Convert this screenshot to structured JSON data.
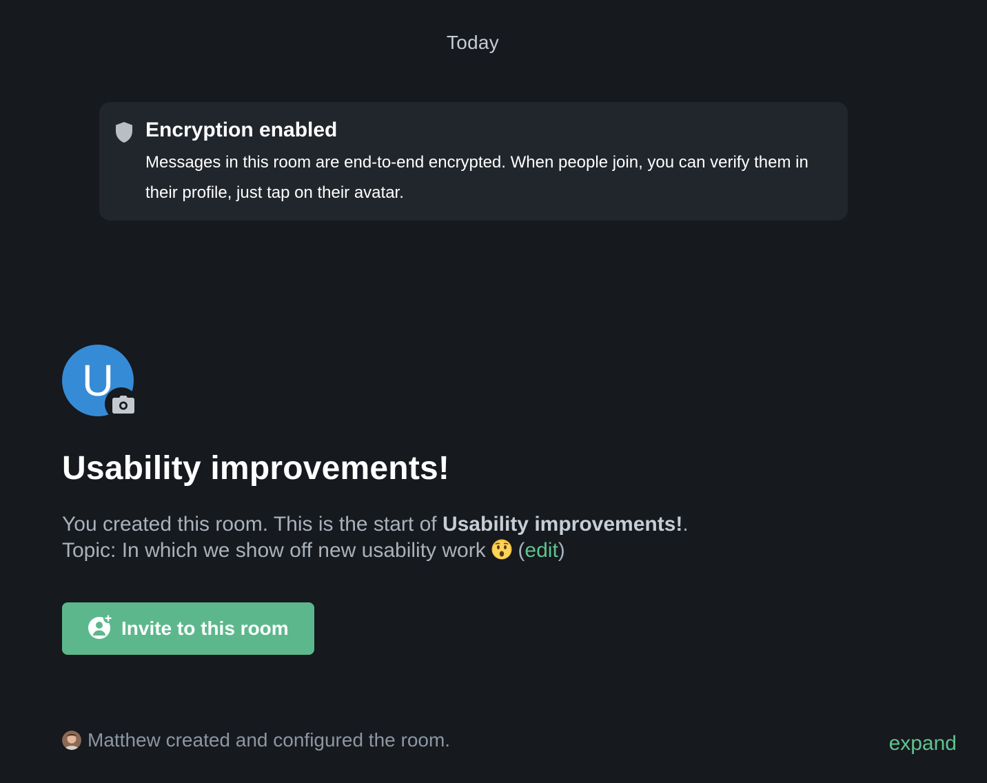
{
  "timeline": {
    "date_separator": "Today"
  },
  "encryption_notice": {
    "icon": "shield-icon",
    "title": "Encryption enabled",
    "body": "Messages in this room are end-to-end encrypted. When people join, you can verify them in their profile, just tap on their avatar."
  },
  "room": {
    "avatar_initial": "U",
    "avatar_color": "#368bd6",
    "avatar_upload_icon": "camera-icon",
    "name": "Usability improvements!",
    "intro_prefix": "You created this room. This is the start of ",
    "intro_room_name": "Usability improvements!",
    "intro_suffix": ".",
    "topic_prefix": "Topic: ",
    "topic": "In which we show off new usability work",
    "topic_emoji": "😯",
    "edit_open": " (",
    "edit_label": "edit",
    "edit_close": ")"
  },
  "invite_button": {
    "icon": "add-user-icon",
    "label": "Invite to this room",
    "color": "#5cb88c"
  },
  "event_summary": {
    "text": "Matthew created and configured the room.",
    "expand_label": "expand"
  },
  "colors": {
    "background": "#16191e",
    "card": "#21262c",
    "accent": "#5fc48f"
  }
}
